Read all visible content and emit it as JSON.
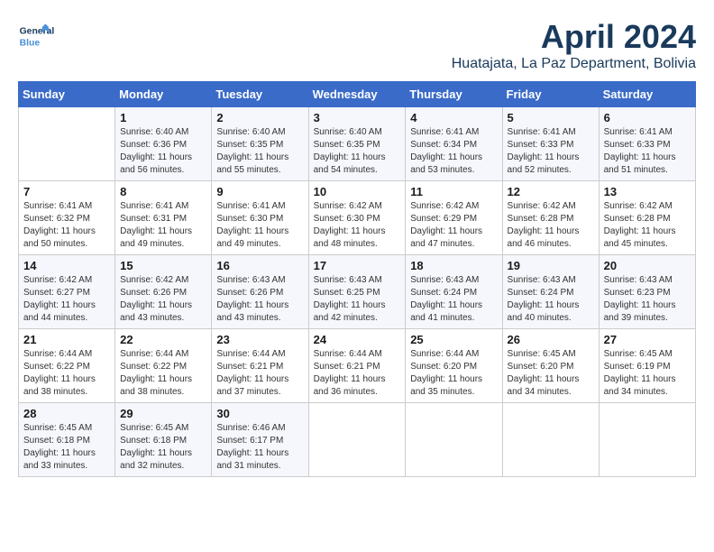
{
  "header": {
    "logo_general": "General",
    "logo_blue": "Blue",
    "month_title": "April 2024",
    "location": "Huatajata, La Paz Department, Bolivia"
  },
  "days_of_week": [
    "Sunday",
    "Monday",
    "Tuesday",
    "Wednesday",
    "Thursday",
    "Friday",
    "Saturday"
  ],
  "weeks": [
    [
      {
        "day": "",
        "sunrise": "",
        "sunset": "",
        "daylight": ""
      },
      {
        "day": "1",
        "sunrise": "Sunrise: 6:40 AM",
        "sunset": "Sunset: 6:36 PM",
        "daylight": "Daylight: 11 hours and 56 minutes."
      },
      {
        "day": "2",
        "sunrise": "Sunrise: 6:40 AM",
        "sunset": "Sunset: 6:35 PM",
        "daylight": "Daylight: 11 hours and 55 minutes."
      },
      {
        "day": "3",
        "sunrise": "Sunrise: 6:40 AM",
        "sunset": "Sunset: 6:35 PM",
        "daylight": "Daylight: 11 hours and 54 minutes."
      },
      {
        "day": "4",
        "sunrise": "Sunrise: 6:41 AM",
        "sunset": "Sunset: 6:34 PM",
        "daylight": "Daylight: 11 hours and 53 minutes."
      },
      {
        "day": "5",
        "sunrise": "Sunrise: 6:41 AM",
        "sunset": "Sunset: 6:33 PM",
        "daylight": "Daylight: 11 hours and 52 minutes."
      },
      {
        "day": "6",
        "sunrise": "Sunrise: 6:41 AM",
        "sunset": "Sunset: 6:33 PM",
        "daylight": "Daylight: 11 hours and 51 minutes."
      }
    ],
    [
      {
        "day": "7",
        "sunrise": "Sunrise: 6:41 AM",
        "sunset": "Sunset: 6:32 PM",
        "daylight": "Daylight: 11 hours and 50 minutes."
      },
      {
        "day": "8",
        "sunrise": "Sunrise: 6:41 AM",
        "sunset": "Sunset: 6:31 PM",
        "daylight": "Daylight: 11 hours and 49 minutes."
      },
      {
        "day": "9",
        "sunrise": "Sunrise: 6:41 AM",
        "sunset": "Sunset: 6:30 PM",
        "daylight": "Daylight: 11 hours and 49 minutes."
      },
      {
        "day": "10",
        "sunrise": "Sunrise: 6:42 AM",
        "sunset": "Sunset: 6:30 PM",
        "daylight": "Daylight: 11 hours and 48 minutes."
      },
      {
        "day": "11",
        "sunrise": "Sunrise: 6:42 AM",
        "sunset": "Sunset: 6:29 PM",
        "daylight": "Daylight: 11 hours and 47 minutes."
      },
      {
        "day": "12",
        "sunrise": "Sunrise: 6:42 AM",
        "sunset": "Sunset: 6:28 PM",
        "daylight": "Daylight: 11 hours and 46 minutes."
      },
      {
        "day": "13",
        "sunrise": "Sunrise: 6:42 AM",
        "sunset": "Sunset: 6:28 PM",
        "daylight": "Daylight: 11 hours and 45 minutes."
      }
    ],
    [
      {
        "day": "14",
        "sunrise": "Sunrise: 6:42 AM",
        "sunset": "Sunset: 6:27 PM",
        "daylight": "Daylight: 11 hours and 44 minutes."
      },
      {
        "day": "15",
        "sunrise": "Sunrise: 6:42 AM",
        "sunset": "Sunset: 6:26 PM",
        "daylight": "Daylight: 11 hours and 43 minutes."
      },
      {
        "day": "16",
        "sunrise": "Sunrise: 6:43 AM",
        "sunset": "Sunset: 6:26 PM",
        "daylight": "Daylight: 11 hours and 43 minutes."
      },
      {
        "day": "17",
        "sunrise": "Sunrise: 6:43 AM",
        "sunset": "Sunset: 6:25 PM",
        "daylight": "Daylight: 11 hours and 42 minutes."
      },
      {
        "day": "18",
        "sunrise": "Sunrise: 6:43 AM",
        "sunset": "Sunset: 6:24 PM",
        "daylight": "Daylight: 11 hours and 41 minutes."
      },
      {
        "day": "19",
        "sunrise": "Sunrise: 6:43 AM",
        "sunset": "Sunset: 6:24 PM",
        "daylight": "Daylight: 11 hours and 40 minutes."
      },
      {
        "day": "20",
        "sunrise": "Sunrise: 6:43 AM",
        "sunset": "Sunset: 6:23 PM",
        "daylight": "Daylight: 11 hours and 39 minutes."
      }
    ],
    [
      {
        "day": "21",
        "sunrise": "Sunrise: 6:44 AM",
        "sunset": "Sunset: 6:22 PM",
        "daylight": "Daylight: 11 hours and 38 minutes."
      },
      {
        "day": "22",
        "sunrise": "Sunrise: 6:44 AM",
        "sunset": "Sunset: 6:22 PM",
        "daylight": "Daylight: 11 hours and 38 minutes."
      },
      {
        "day": "23",
        "sunrise": "Sunrise: 6:44 AM",
        "sunset": "Sunset: 6:21 PM",
        "daylight": "Daylight: 11 hours and 37 minutes."
      },
      {
        "day": "24",
        "sunrise": "Sunrise: 6:44 AM",
        "sunset": "Sunset: 6:21 PM",
        "daylight": "Daylight: 11 hours and 36 minutes."
      },
      {
        "day": "25",
        "sunrise": "Sunrise: 6:44 AM",
        "sunset": "Sunset: 6:20 PM",
        "daylight": "Daylight: 11 hours and 35 minutes."
      },
      {
        "day": "26",
        "sunrise": "Sunrise: 6:45 AM",
        "sunset": "Sunset: 6:20 PM",
        "daylight": "Daylight: 11 hours and 34 minutes."
      },
      {
        "day": "27",
        "sunrise": "Sunrise: 6:45 AM",
        "sunset": "Sunset: 6:19 PM",
        "daylight": "Daylight: 11 hours and 34 minutes."
      }
    ],
    [
      {
        "day": "28",
        "sunrise": "Sunrise: 6:45 AM",
        "sunset": "Sunset: 6:18 PM",
        "daylight": "Daylight: 11 hours and 33 minutes."
      },
      {
        "day": "29",
        "sunrise": "Sunrise: 6:45 AM",
        "sunset": "Sunset: 6:18 PM",
        "daylight": "Daylight: 11 hours and 32 minutes."
      },
      {
        "day": "30",
        "sunrise": "Sunrise: 6:46 AM",
        "sunset": "Sunset: 6:17 PM",
        "daylight": "Daylight: 11 hours and 31 minutes."
      },
      {
        "day": "",
        "sunrise": "",
        "sunset": "",
        "daylight": ""
      },
      {
        "day": "",
        "sunrise": "",
        "sunset": "",
        "daylight": ""
      },
      {
        "day": "",
        "sunrise": "",
        "sunset": "",
        "daylight": ""
      },
      {
        "day": "",
        "sunrise": "",
        "sunset": "",
        "daylight": ""
      }
    ]
  ]
}
